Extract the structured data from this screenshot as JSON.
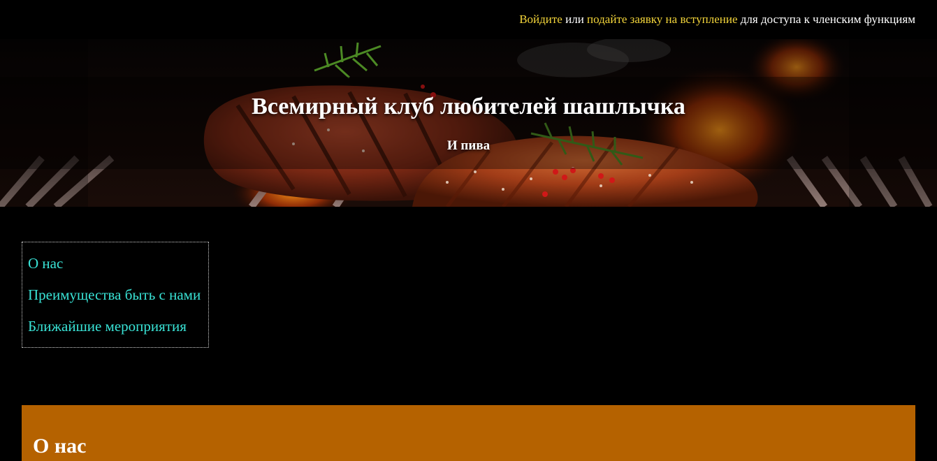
{
  "header": {
    "login_link": "Войдите",
    "or_text": "или",
    "apply_link": "подайте заявку на вступление",
    "tail_text": "для доступа к членским функциям"
  },
  "hero": {
    "title": "Всемирный клуб любителей шашлычка",
    "subtitle": "И пива",
    "image": "grilled-steak-on-bbq-grill"
  },
  "nav": {
    "items": [
      {
        "label": "О нас"
      },
      {
        "label": "Преимущества быть с нами"
      },
      {
        "label": "Ближайшие мероприятия"
      }
    ]
  },
  "about": {
    "heading": "О нас"
  },
  "colors": {
    "background": "#000000",
    "link_yellow": "#f2d43a",
    "nav_link": "#39e3d6",
    "section_orange": "#b56200"
  }
}
